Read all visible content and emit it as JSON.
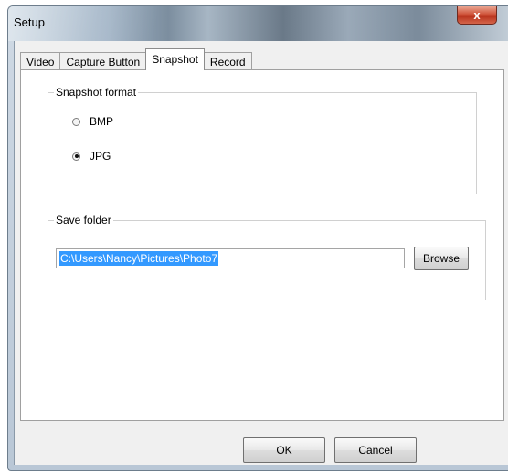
{
  "window": {
    "title": "Setup",
    "close_label": "x"
  },
  "tabs": [
    {
      "label": "Video",
      "active": false
    },
    {
      "label": "Capture Button",
      "active": false
    },
    {
      "label": "Snapshot",
      "active": true
    },
    {
      "label": "Record",
      "active": false
    }
  ],
  "snapshot_format": {
    "label": "Snapshot format",
    "options": [
      {
        "label": "BMP",
        "checked": false
      },
      {
        "label": "JPG",
        "checked": true
      }
    ]
  },
  "save_folder": {
    "label": "Save folder",
    "path": "C:\\Users\\Nancy\\Pictures\\Photo7",
    "browse_label": "Browse"
  },
  "footer": {
    "ok_label": "OK",
    "cancel_label": "Cancel"
  }
}
